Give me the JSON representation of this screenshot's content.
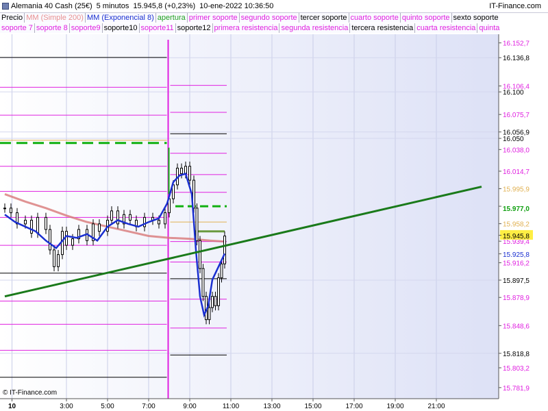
{
  "header": {
    "instrument": "Alemania 40 Cash (25€)",
    "timeframe": "5 minutos",
    "price": "15.945,8 (+0,23%)",
    "datetime": "10-ene-2022 10:36:50",
    "brand": "IT-Finance.com"
  },
  "legend_row1": [
    {
      "label": "Precio",
      "color": "#000000"
    },
    {
      "label": "MM (Simple 200)",
      "color": "#e89090"
    },
    {
      "label": "MM (Exponencial 8)",
      "color": "#1a2fd0"
    },
    {
      "label": "apertura",
      "color": "#20a020"
    },
    {
      "label": "primer soporte",
      "color": "#e020e0"
    },
    {
      "label": "segundo soporte",
      "color": "#e020e0"
    },
    {
      "label": "tercer soporte",
      "color": "#000000"
    },
    {
      "label": "cuarto soporte",
      "color": "#e020e0"
    },
    {
      "label": "quinto soporte",
      "color": "#e020e0"
    },
    {
      "label": "sexto soporte",
      "color": "#000000"
    }
  ],
  "legend_row2": [
    {
      "label": "soporte 7",
      "color": "#e020e0"
    },
    {
      "label": "soporte 8",
      "color": "#e020e0"
    },
    {
      "label": "soporte9",
      "color": "#e020e0"
    },
    {
      "label": "soporte10",
      "color": "#000000"
    },
    {
      "label": "soporte11",
      "color": "#e020e0"
    },
    {
      "label": "soporte12",
      "color": "#000000"
    },
    {
      "label": "primera resistencia",
      "color": "#e020e0"
    },
    {
      "label": "segunda resistencia",
      "color": "#e020e0"
    },
    {
      "label": "tercera resistencia",
      "color": "#000000"
    },
    {
      "label": "cuarta resistencia",
      "color": "#e020e0"
    },
    {
      "label": "quinta resistencia",
      "color": "#e020e0"
    }
  ],
  "copyright": "© IT-Finance.com",
  "colors": {
    "magenta": "#e020e0",
    "black": "#000000",
    "orange": "#e0b050",
    "green_dash": "#10b010",
    "trend": "#1a7a1a",
    "sma": "#d87878",
    "ema": "#1a2fd0",
    "pivot": "#6a9a40"
  },
  "chart_data": {
    "type": "candlestick",
    "ylim": [
      15770,
      16162
    ],
    "x_ticks": [
      {
        "h": 0.35,
        "label": "10",
        "bold": true
      },
      {
        "h": 3,
        "label": "3:00"
      },
      {
        "h": 5,
        "label": "5:00"
      },
      {
        "h": 7,
        "label": "7:00"
      },
      {
        "h": 9,
        "label": "9:00"
      },
      {
        "h": 11,
        "label": "11:00"
      },
      {
        "h": 13,
        "label": "13:00"
      },
      {
        "h": 15,
        "label": "15:00"
      },
      {
        "h": 17,
        "label": "17:00"
      },
      {
        "h": 19,
        "label": "19:00"
      },
      {
        "h": 21,
        "label": "21:00"
      }
    ],
    "axis_ticks": [
      {
        "v": 16136.8,
        "label": "16.136,8"
      },
      {
        "v": 16100,
        "label": "16.100"
      },
      {
        "v": 16056.9,
        "label": "16.056,9"
      },
      {
        "v": 16050,
        "label": "16.050"
      },
      {
        "v": 15897.5,
        "label": "15.897,5"
      },
      {
        "v": 15818.8,
        "label": "15.818,8"
      }
    ],
    "level_labels": [
      {
        "v": 16152.7,
        "label": "16.152,7",
        "color": "#e020e0"
      },
      {
        "v": 16106.4,
        "label": "16.106,4",
        "color": "#e020e0"
      },
      {
        "v": 16075.7,
        "label": "16.075,7",
        "color": "#e020e0"
      },
      {
        "v": 16038.0,
        "label": "16.038,0",
        "color": "#e020e0"
      },
      {
        "v": 16014.7,
        "label": "16.014,7",
        "color": "#e020e0"
      },
      {
        "v": 15995.9,
        "label": "15.995,9",
        "color": "#e0b050"
      },
      {
        "v": 15958.2,
        "label": "15.958,2",
        "color": "#e0b050"
      },
      {
        "v": 15939.4,
        "label": "15.939,4",
        "color": "#e020e0"
      },
      {
        "v": 15916.2,
        "label": "15.916,2",
        "color": "#e020e0"
      },
      {
        "v": 15878.9,
        "label": "15.878,9",
        "color": "#e020e0"
      },
      {
        "v": 15848.6,
        "label": "15.848,6",
        "color": "#e020e0"
      },
      {
        "v": 15803.2,
        "label": "15.803,2",
        "color": "#e020e0"
      },
      {
        "v": 15781.9,
        "label": "15.781,9",
        "color": "#e020e0"
      }
    ],
    "highlight_labels": [
      {
        "v": 15977.0,
        "label": "15.977,0",
        "color": "#10a010",
        "bg": "#ffffff",
        "size": 16
      },
      {
        "v": 15945.8,
        "label": "15.945,8",
        "color": "#000000",
        "bg": "#ffee44",
        "size": 11
      },
      {
        "v": 15925.8,
        "label": "15.925,8",
        "color": "#1a2fd0",
        "bg": "#ffffff",
        "size": 11
      }
    ],
    "prev_levels": [
      {
        "v": 16137,
        "color": "#000000"
      },
      {
        "v": 16105,
        "color": "#e020e0"
      },
      {
        "v": 16075,
        "color": "#e020e0"
      },
      {
        "v": 16048,
        "color": "#e0b050"
      },
      {
        "v": 16020,
        "color": "#e020e0"
      },
      {
        "v": 15993,
        "color": "#e020e0"
      },
      {
        "v": 15965,
        "color": "#e020e0"
      },
      {
        "v": 15935,
        "color": "#e020e0"
      },
      {
        "v": 15905,
        "color": "#000000"
      },
      {
        "v": 15875,
        "color": "#e020e0"
      },
      {
        "v": 15850,
        "color": "#e020e0"
      },
      {
        "v": 15822,
        "color": "#e020e0"
      },
      {
        "v": 15793,
        "color": "#000000"
      },
      {
        "v": 15762,
        "color": "#e020e0"
      }
    ],
    "prev_green": 16045,
    "session_break_h": 7.95,
    "cur_levels": [
      {
        "v": 16107,
        "color": "#e020e0"
      },
      {
        "v": 16078,
        "color": "#e020e0"
      },
      {
        "v": 16055,
        "color": "#000000"
      },
      {
        "v": 16034,
        "color": "#e020e0"
      },
      {
        "v": 16011,
        "color": "#e020e0"
      },
      {
        "v": 15992,
        "color": "#e020e0"
      },
      {
        "v": 15960,
        "color": "#e0b050"
      },
      {
        "v": 15939,
        "color": "#e020e0"
      },
      {
        "v": 15917,
        "color": "#e020e0"
      },
      {
        "v": 15899,
        "color": "#000000"
      },
      {
        "v": 15877,
        "color": "#e020e0"
      },
      {
        "v": 15846,
        "color": "#e020e0"
      },
      {
        "v": 15817,
        "color": "#000000"
      }
    ],
    "cur_green": 15977,
    "cur_green_range": [
      8.3,
      10.8
    ],
    "trendline": {
      "h1": 0,
      "v1": 15880,
      "h2": 23.2,
      "v2": 15998
    },
    "sma_points": [
      [
        0,
        15990
      ],
      [
        1,
        15982
      ],
      [
        2,
        15975
      ],
      [
        3,
        15967
      ],
      [
        4,
        15960
      ],
      [
        5,
        15955
      ],
      [
        6,
        15950
      ],
      [
        7,
        15945
      ],
      [
        8,
        15943
      ],
      [
        9,
        15942
      ],
      [
        10,
        15940
      ],
      [
        10.7,
        15939
      ]
    ],
    "ema_points": [
      [
        0,
        15968
      ],
      [
        0.5,
        15960
      ],
      [
        1,
        15955
      ],
      [
        1.5,
        15950
      ],
      [
        2,
        15940
      ],
      [
        2.5,
        15932
      ],
      [
        3,
        15945
      ],
      [
        3.5,
        15943
      ],
      [
        4,
        15947
      ],
      [
        4.5,
        15940
      ],
      [
        5,
        15955
      ],
      [
        5.5,
        15962
      ],
      [
        6,
        15958
      ],
      [
        6.5,
        15955
      ],
      [
        7,
        15960
      ],
      [
        7.5,
        15964
      ],
      [
        7.9,
        15980
      ],
      [
        8.2,
        16003
      ],
      [
        8.5,
        16010
      ],
      [
        8.8,
        16012
      ],
      [
        9.1,
        15990
      ],
      [
        9.3,
        15930
      ],
      [
        9.5,
        15880
      ],
      [
        9.7,
        15860
      ],
      [
        9.9,
        15870
      ],
      [
        10.1,
        15898
      ],
      [
        10.4,
        15912
      ],
      [
        10.7,
        15926
      ]
    ],
    "pivot_segment": {
      "h1": 9.2,
      "h2": 10.7,
      "v": 15950
    },
    "price_points": [
      [
        0,
        15975
      ],
      [
        0.3,
        15970
      ],
      [
        0.6,
        15958
      ],
      [
        1,
        15962
      ],
      [
        1.3,
        15948
      ],
      [
        1.6,
        15965
      ],
      [
        2,
        15952
      ],
      [
        2.2,
        15930
      ],
      [
        2.4,
        15912
      ],
      [
        2.6,
        15925
      ],
      [
        2.8,
        15950
      ],
      [
        3,
        15935
      ],
      [
        3.3,
        15942
      ],
      [
        3.6,
        15952
      ],
      [
        4,
        15940
      ],
      [
        4.3,
        15958
      ],
      [
        4.6,
        15950
      ],
      [
        5,
        15962
      ],
      [
        5.2,
        15972
      ],
      [
        5.5,
        15958
      ],
      [
        5.8,
        15968
      ],
      [
        6.1,
        15962
      ],
      [
        6.4,
        15955
      ],
      [
        6.8,
        15965
      ],
      [
        7.2,
        15962
      ],
      [
        7.5,
        15958
      ],
      [
        7.8,
        15970
      ],
      [
        8.0,
        15985
      ],
      [
        8.2,
        16000
      ],
      [
        8.4,
        16018
      ],
      [
        8.6,
        16012
      ],
      [
        8.8,
        16020
      ],
      [
        9.0,
        16005
      ],
      [
        9.2,
        15975
      ],
      [
        9.35,
        15940
      ],
      [
        9.5,
        15910
      ],
      [
        9.65,
        15880
      ],
      [
        9.8,
        15855
      ],
      [
        9.95,
        15868
      ],
      [
        10.1,
        15880
      ],
      [
        10.25,
        15870
      ],
      [
        10.4,
        15900
      ],
      [
        10.55,
        15915
      ],
      [
        10.7,
        15945
      ]
    ]
  }
}
